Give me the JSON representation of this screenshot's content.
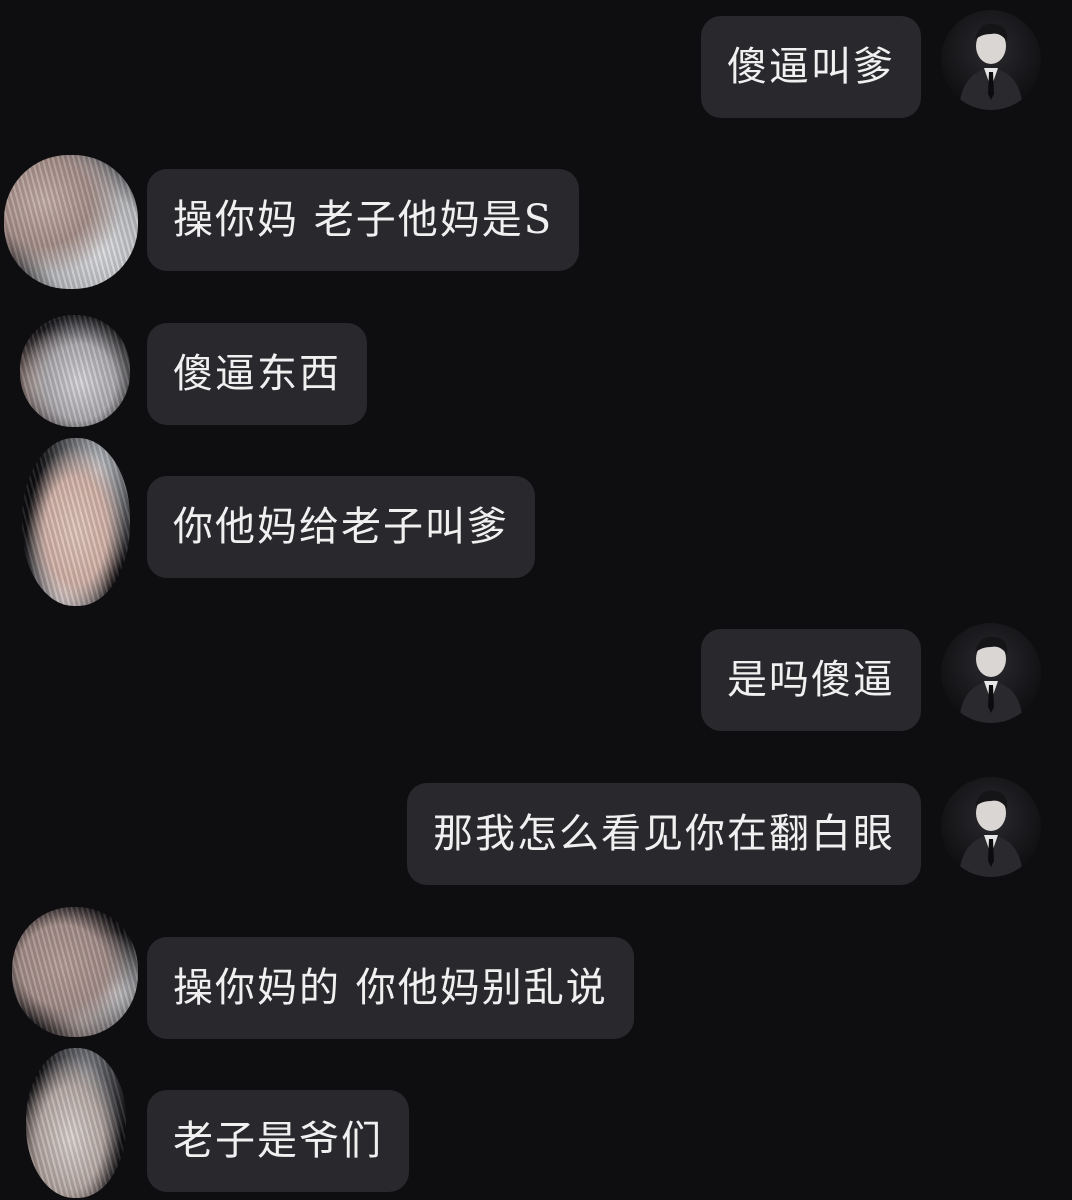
{
  "conversation": {
    "messages": [
      {
        "side": "out",
        "text": "傻逼叫爹",
        "avatar": "portrait-avatar"
      },
      {
        "side": "in",
        "text": "操你妈 老子他妈是S",
        "avatar": "scribbled-avatar"
      },
      {
        "side": "in",
        "text": "傻逼东西",
        "avatar": "scribbled-avatar"
      },
      {
        "side": "in",
        "text": "你他妈给老子叫爹",
        "avatar": "scribbled-avatar"
      },
      {
        "side": "out",
        "text": "是吗傻逼",
        "avatar": "portrait-avatar"
      },
      {
        "side": "out",
        "text": "那我怎么看见你在翻白眼",
        "avatar": "portrait-avatar"
      },
      {
        "side": "in",
        "text": "操你妈的 你他妈别乱说",
        "avatar": "scribbled-avatar"
      },
      {
        "side": "in",
        "text": "老子是爷们",
        "avatar": "scribbled-avatar"
      }
    ]
  },
  "theme": {
    "background": "#0e0d10",
    "bubble": "#29282c",
    "text": "#f1f0f0"
  }
}
